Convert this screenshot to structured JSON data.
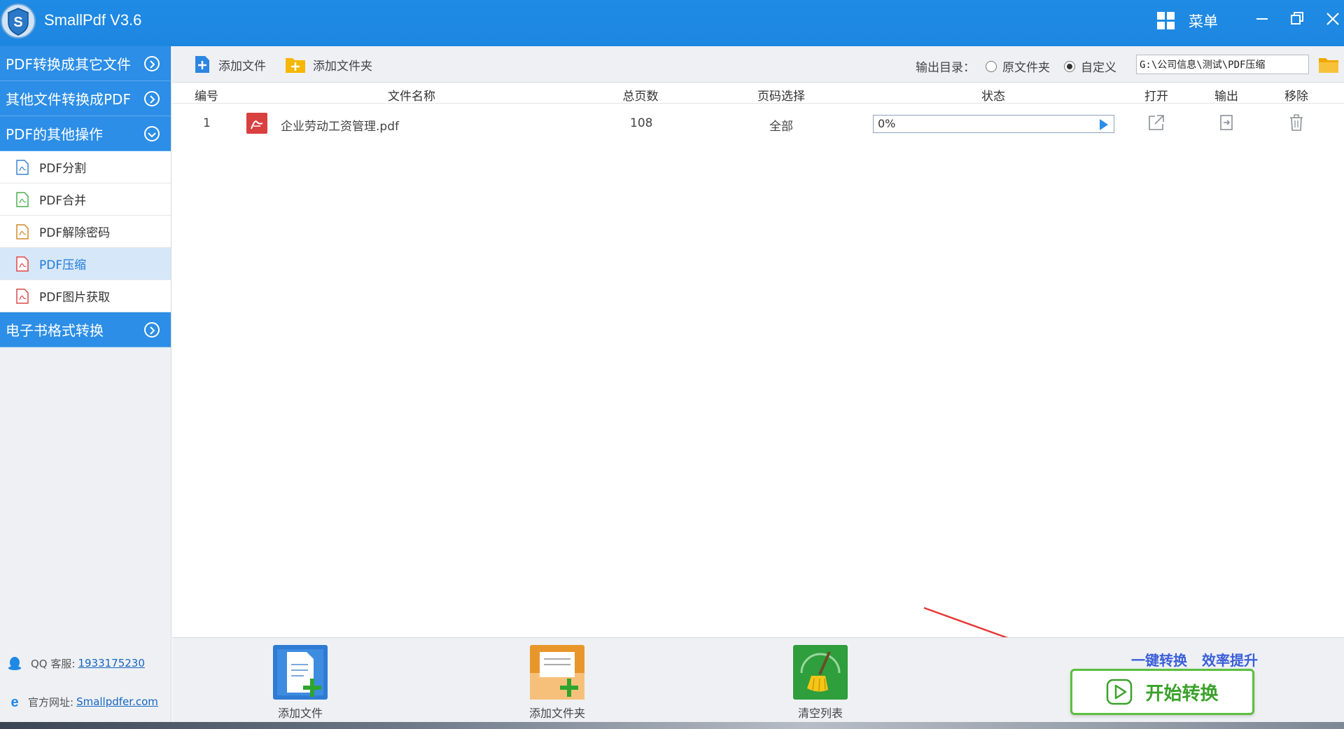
{
  "titlebar": {
    "title": "SmallPdf V3.6",
    "menu_label": "菜单",
    "logo_letter": "S"
  },
  "sidebar": {
    "categories": [
      {
        "label": "PDF转换成其它文件"
      },
      {
        "label": "其他文件转换成PDF"
      },
      {
        "label": "PDF的其他操作"
      },
      {
        "label": "电子书格式转换"
      }
    ],
    "sub_items": [
      {
        "label": "PDF分割",
        "color": "#3b82d6"
      },
      {
        "label": "PDF合并",
        "color": "#4caf50"
      },
      {
        "label": "PDF解除密码",
        "color": "#d08a2c"
      },
      {
        "label": "PDF压缩",
        "color": "#e04646"
      },
      {
        "label": "PDF图片获取",
        "color": "#d84a4a"
      }
    ],
    "footer": {
      "qq_label": "QQ 客服:",
      "qq_number": "1933175230",
      "site_label": "官方网址:",
      "site_url": "Smallpdfer.com"
    }
  },
  "toolbar": {
    "add_file": "添加文件",
    "add_folder": "添加文件夹",
    "output_dir_label": "输出目录：",
    "radio_original": "原文件夹",
    "radio_custom": "自定义",
    "path_value": "G:\\公司信息\\测试\\PDF压缩"
  },
  "table": {
    "headers": {
      "index": "编号",
      "filename": "文件名称",
      "pages": "总页数",
      "page_select": "页码选择",
      "status": "状态",
      "open": "打开",
      "output": "输出",
      "remove": "移除"
    },
    "rows": [
      {
        "index": "1",
        "filename": "企业劳动工资管理.pdf",
        "pages": "108",
        "page_select": "全部",
        "progress": "0%"
      }
    ]
  },
  "bottom": {
    "add_file": "添加文件",
    "add_folder": "添加文件夹",
    "clear_list": "清空列表",
    "slogan_1": "一键转换",
    "slogan_2": "效率提升",
    "start_label": "开始转换"
  },
  "colors": {
    "titlebar": "#1f8be4",
    "sidebar_category": "#2c8ee6",
    "active_sub": "#d6e7fa",
    "start_green": "#3aa12a",
    "slogan_blue": "#3b5fd9"
  }
}
